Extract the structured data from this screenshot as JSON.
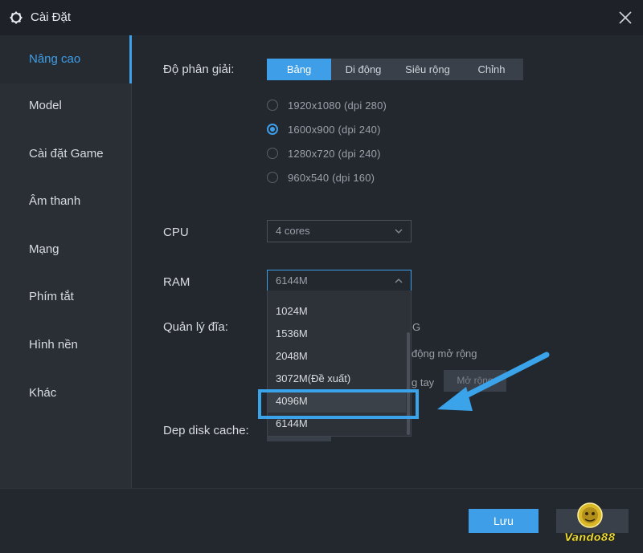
{
  "window": {
    "title": "Cài Đặt"
  },
  "sidebar": {
    "items": [
      {
        "label": "Nâng cao",
        "active": true
      },
      {
        "label": "Model"
      },
      {
        "label": "Cài đặt Game"
      },
      {
        "label": "Âm thanh"
      },
      {
        "label": "Mạng"
      },
      {
        "label": "Phím tắt"
      },
      {
        "label": "Hình nền"
      },
      {
        "label": "Khác"
      }
    ]
  },
  "resolution": {
    "label": "Độ phân giải:",
    "tabs": [
      "Bảng",
      "Di động",
      "Siêu rộng",
      "Chỉnh"
    ],
    "active_tab": "Bảng",
    "options": [
      {
        "label": "1920x1080  (dpi 280)",
        "selected": false
      },
      {
        "label": "1600x900  (dpi 240)",
        "selected": true
      },
      {
        "label": "1280x720  (dpi 240)",
        "selected": false
      },
      {
        "label": "960x540  (dpi 160)",
        "selected": false
      }
    ]
  },
  "cpu": {
    "label": "CPU",
    "value": "4 cores"
  },
  "ram": {
    "label": "RAM",
    "value": "6144M",
    "options": [
      "1024M",
      "1536M",
      "2048M",
      "3072M(Đề xuất)",
      "4096M",
      "6144M"
    ],
    "hovered": "4096M"
  },
  "disk": {
    "label": "Quản lý đĩa:",
    "partial_texts": [
      "G",
      "động mở rộng",
      "g tay"
    ],
    "expand_button": "Mở rộng"
  },
  "cache": {
    "label": "Dep disk cache:"
  },
  "footer": {
    "save_label": "Lưu"
  },
  "watermark": {
    "brand": "Vando88"
  },
  "colors": {
    "accent": "#3e9fe8",
    "background": "#23272e",
    "sidebar": "#2a2f36",
    "highlight": "#3aa3ea"
  }
}
